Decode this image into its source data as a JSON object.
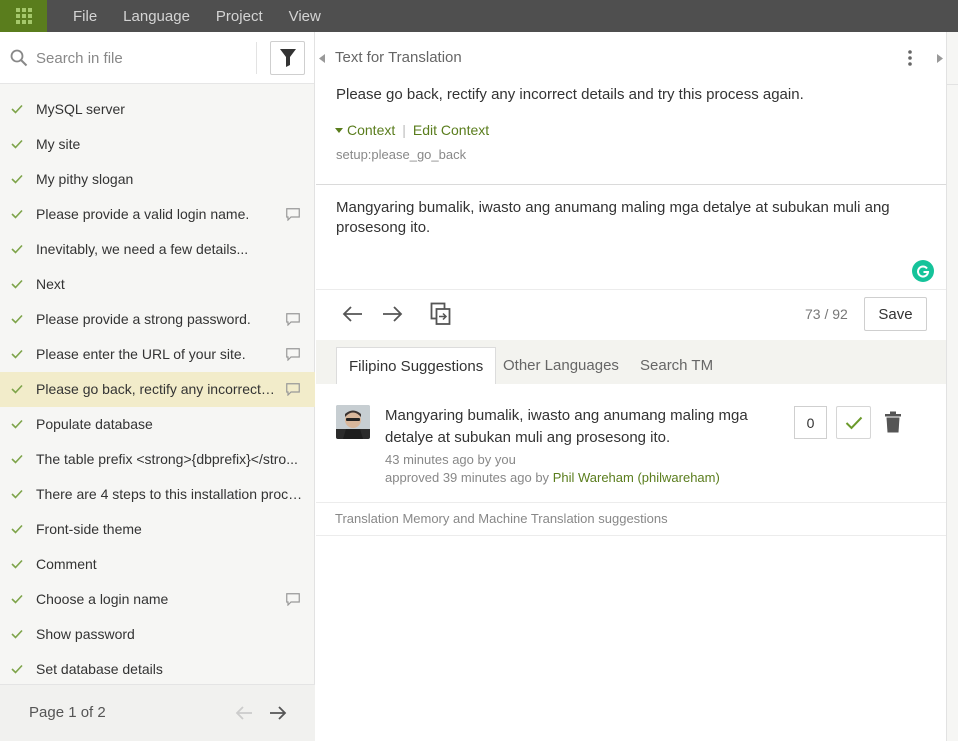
{
  "menubar": {
    "items": [
      "File",
      "Language",
      "Project",
      "View"
    ]
  },
  "sidebar": {
    "search_placeholder": "Search in file",
    "items": [
      {
        "label": "MySQL server",
        "comment": false,
        "active": false
      },
      {
        "label": "My site",
        "comment": false,
        "active": false
      },
      {
        "label": "My pithy slogan",
        "comment": false,
        "active": false
      },
      {
        "label": "Please provide a valid login name.",
        "comment": true,
        "active": false
      },
      {
        "label": "Inevitably, we need a few details...",
        "comment": false,
        "active": false
      },
      {
        "label": "Next",
        "comment": false,
        "active": false
      },
      {
        "label": "Please provide a strong password.",
        "comment": true,
        "active": false
      },
      {
        "label": "Please enter the URL of your site.",
        "comment": true,
        "active": false
      },
      {
        "label": "Please go back, rectify any incorrect d...",
        "comment": true,
        "active": true
      },
      {
        "label": "Populate database",
        "comment": false,
        "active": false
      },
      {
        "label": "The table prefix <strong>{dbprefix}</stro...",
        "comment": false,
        "active": false
      },
      {
        "label": "There are 4 steps to this installation proce...",
        "comment": false,
        "active": false
      },
      {
        "label": "Front-side theme",
        "comment": false,
        "active": false
      },
      {
        "label": "Comment",
        "comment": false,
        "active": false
      },
      {
        "label": "Choose a login name",
        "comment": true,
        "active": false
      },
      {
        "label": "Show password",
        "comment": false,
        "active": false
      },
      {
        "label": "Set database details",
        "comment": false,
        "active": false
      }
    ],
    "page_label": "Page 1 of 2"
  },
  "source": {
    "title": "Text for Translation",
    "text": "Please go back, rectify any incorrect details and try this process again.",
    "context_label": "Context",
    "edit_context_label": "Edit Context",
    "key": "setup:please_go_back"
  },
  "target": {
    "text": "Mangyaring bumalik, iwasto ang anumang maling mga detalye at subukan muli ang prosesong ito."
  },
  "toolbar": {
    "counter": "73 / 92",
    "save_label": "Save"
  },
  "tabs": [
    {
      "label": "Filipino Suggestions",
      "active": true
    },
    {
      "label": "Other Languages",
      "active": false
    },
    {
      "label": "Search TM",
      "active": false
    }
  ],
  "suggestion": {
    "text": "Mangyaring bumalik, iwasto ang anumang maling mga detalye at subukan muli ang prosesong ito.",
    "meta_time": "43 minutes ago by you",
    "meta_approved_prefix": "approved 39 minutes ago by",
    "meta_approved_user": "Phil Wareham (philwareham)",
    "votes": "0"
  },
  "tm_note": "Translation Memory and Machine Translation suggestions",
  "colors": {
    "accent": "#5a7d1d",
    "menubar": "#4f4f4f",
    "active_row": "#f2ecca",
    "grammarly": "#15c39a"
  }
}
